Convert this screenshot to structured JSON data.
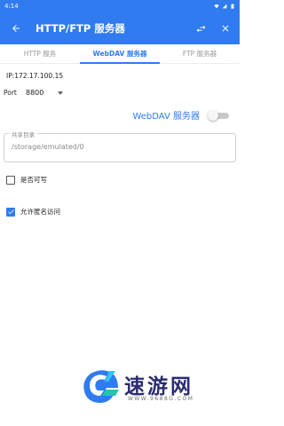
{
  "status_bar": {
    "time": "4:14"
  },
  "app_bar": {
    "title": "HTTP/FTP 服务器"
  },
  "tabs": [
    {
      "label": "HTTP 服务",
      "active": false
    },
    {
      "label": "WebDAV 服务器",
      "active": true
    },
    {
      "label": "FTP 服务器",
      "active": false
    }
  ],
  "ip": {
    "text": "IP:172.17.100.15"
  },
  "port": {
    "label": "Port",
    "value": "8800"
  },
  "server": {
    "label": "WebDAV 服务器",
    "enabled": false
  },
  "share_dir": {
    "label": "共享目录",
    "value": "/storage/emulated/0"
  },
  "options": {
    "writable": {
      "label": "是否可写",
      "checked": false
    },
    "anonymous": {
      "label": "允许匿名访问",
      "checked": true
    }
  },
  "watermark": {
    "name": "速游网",
    "url": "WWW.9688G.COM"
  },
  "colors": {
    "primary": "#2f7bef",
    "watermark_text": "#2a2d6f"
  }
}
